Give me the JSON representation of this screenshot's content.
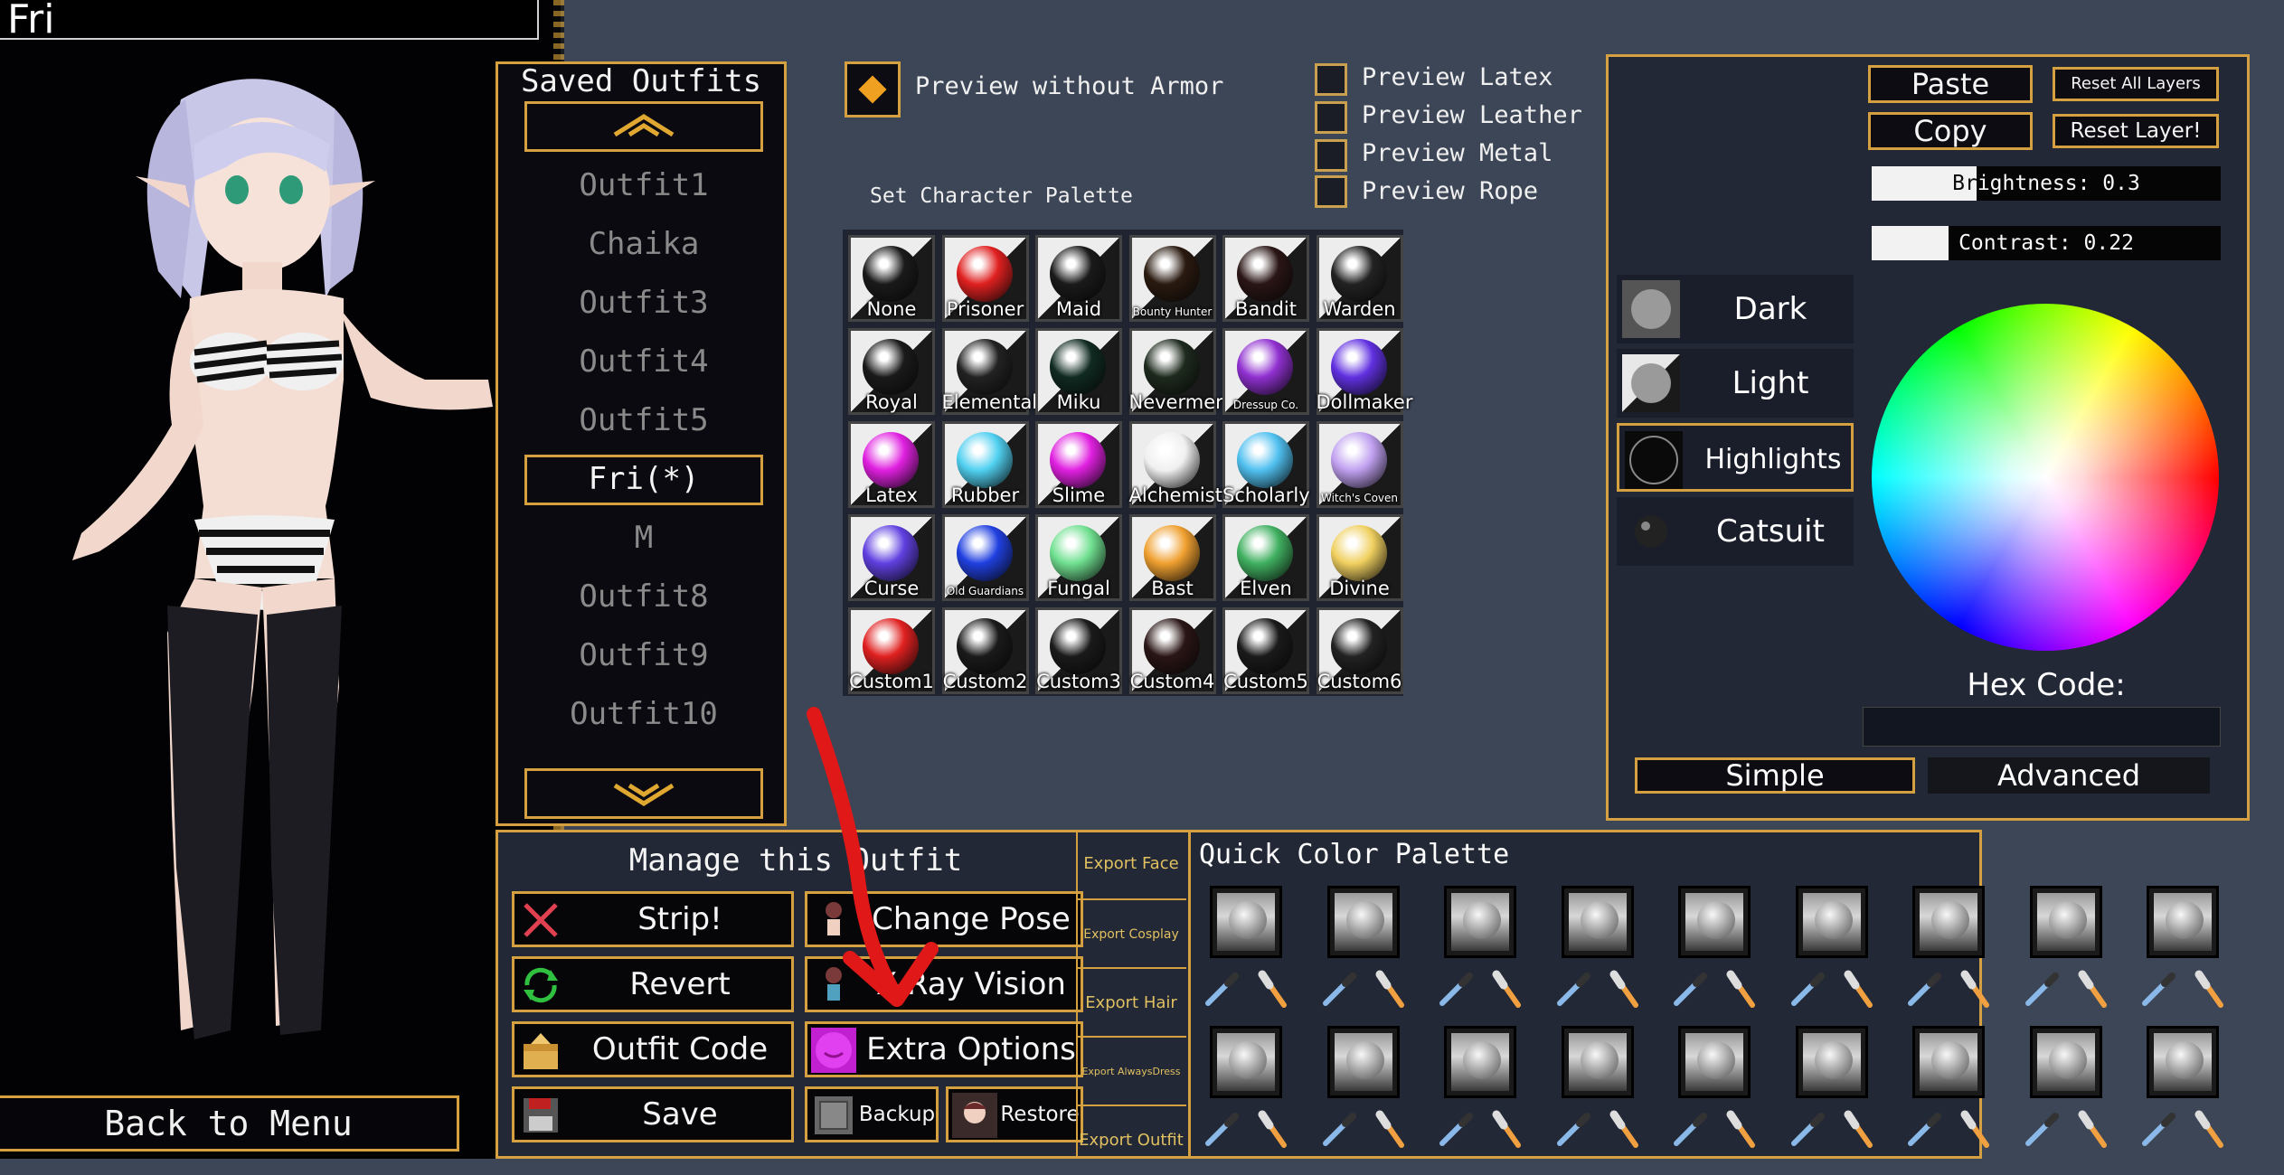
{
  "character": {
    "name": "Fri"
  },
  "back_button": "Back to Menu",
  "saved_outfits": {
    "title": "Saved Outfits",
    "items": [
      "Outfit1",
      "Chaika",
      "Outfit3",
      "Outfit4",
      "Outfit5",
      "Fri(*)",
      "M",
      "Outfit8",
      "Outfit9",
      "Outfit10"
    ],
    "selected": "Fri(*)"
  },
  "preview": {
    "without_armor": "Preview without Armor",
    "latex": "Preview Latex",
    "leather": "Preview Leather",
    "metal": "Preview Metal",
    "rope": "Preview Rope"
  },
  "palette": {
    "label": "Set Character Palette",
    "rows": [
      [
        {
          "n": "None",
          "c": "#1a1a1a"
        },
        {
          "n": "Prisoner",
          "c": "#e02020"
        },
        {
          "n": "Maid",
          "c": "#1a1a1a"
        },
        {
          "n": "Bounty Hunter",
          "c": "#2a1a10",
          "s": 1
        },
        {
          "n": "Bandit",
          "c": "#2a1515"
        },
        {
          "n": "Warden",
          "c": "#222222"
        }
      ],
      [
        {
          "n": "Royal",
          "c": "#1a1a1a"
        },
        {
          "n": "Elemental",
          "c": "#222222"
        },
        {
          "n": "Miku",
          "c": "#102a22"
        },
        {
          "n": "Nevermere",
          "c": "#1e2a1e"
        },
        {
          "n": "Dressup Co.",
          "c": "#9030d0",
          "s": 1
        },
        {
          "n": "Dollmaker",
          "c": "#6030e0"
        }
      ],
      [
        {
          "n": "Latex",
          "c": "#e020e0"
        },
        {
          "n": "Rubber",
          "c": "#50d0f0"
        },
        {
          "n": "Slime",
          "c": "#e020e0"
        },
        {
          "n": "Alchemist",
          "c": "#f0f0f0"
        },
        {
          "n": "Scholarly",
          "c": "#50c0f0"
        },
        {
          "n": "Witch's Coven",
          "c": "#c0a0f0",
          "s": 1
        }
      ],
      [
        {
          "n": "Curse",
          "c": "#6040e0"
        },
        {
          "n": "Old Guardians",
          "c": "#2040e0",
          "s": 1
        },
        {
          "n": "Fungal",
          "c": "#70e090"
        },
        {
          "n": "Bast",
          "c": "#f0a030"
        },
        {
          "n": "Elven",
          "c": "#40b060"
        },
        {
          "n": "Divine",
          "c": "#f0d060"
        }
      ],
      [
        {
          "n": "Custom1",
          "c": "#e02020"
        },
        {
          "n": "Custom2",
          "c": "#1a1a1a"
        },
        {
          "n": "Custom3",
          "c": "#1a1a1a"
        },
        {
          "n": "Custom4",
          "c": "#2a1515"
        },
        {
          "n": "Custom5",
          "c": "#1a1a1a"
        },
        {
          "n": "Custom6",
          "c": "#222222"
        }
      ]
    ]
  },
  "color_panel": {
    "paste": "Paste",
    "copy": "Copy",
    "reset_all": "Reset All Layers",
    "reset_layer": "Reset Layer!",
    "brightness": "Brightness: 0.3",
    "brightness_value": 0.3,
    "contrast": "Contrast: 0.22",
    "contrast_value": 0.22,
    "layers": [
      "Dark",
      "Light",
      "Highlights",
      "Catsuit"
    ],
    "selected_layer": "Highlights",
    "hex_label": "Hex Code:",
    "hex_value": "",
    "simple": "Simple",
    "advanced": "Advanced"
  },
  "manage": {
    "title": "Manage this Outfit",
    "strip": "Strip!",
    "revert": "Revert",
    "outfit_code": "Outfit Code",
    "save": "Save",
    "change_pose": "Change Pose",
    "xray": "X-Ray Vision",
    "extra": "Extra Options",
    "backup": "Backup",
    "restore": "Restore"
  },
  "export": [
    "Export Face",
    "Export Cosplay",
    "Export Hair",
    "Export AlwaysDress",
    "Export Outfit"
  ],
  "quick_palette": {
    "title": "Quick Color Palette",
    "columns": 9,
    "rows": 2
  }
}
